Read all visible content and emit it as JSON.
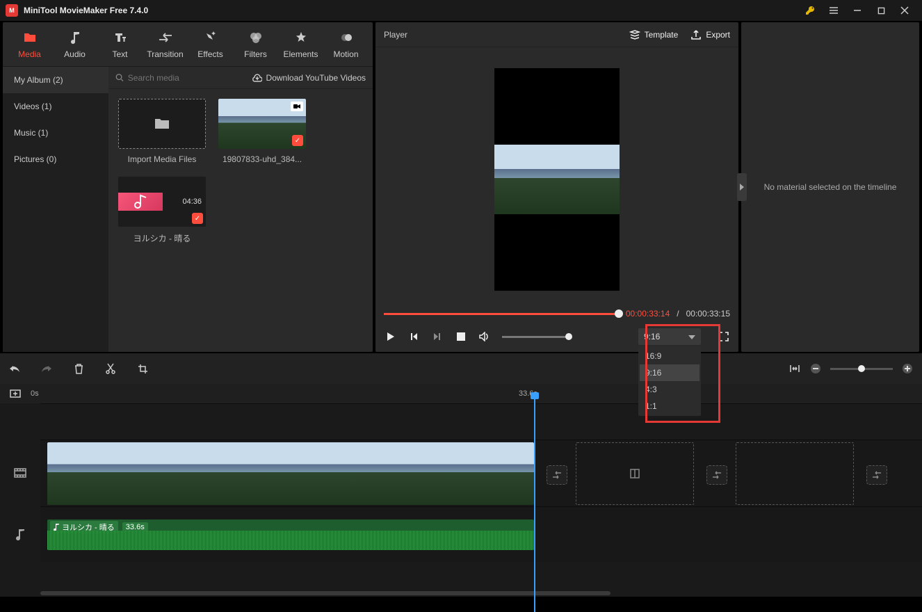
{
  "titlebar": {
    "title": "MiniTool MovieMaker Free 7.4.0"
  },
  "tabs": {
    "media": "Media",
    "audio": "Audio",
    "text": "Text",
    "transition": "Transition",
    "effects": "Effects",
    "filters": "Filters",
    "elements": "Elements",
    "motion": "Motion"
  },
  "media": {
    "sidebar": {
      "album": "My Album (2)",
      "videos": "Videos (1)",
      "music": "Music (1)",
      "pictures": "Pictures (0)"
    },
    "search_placeholder": "Search media",
    "download_link": "Download YouTube Videos",
    "import_label": "Import Media Files",
    "clip1": "19807833-uhd_384...",
    "clip2": {
      "label": "ヨルシカ - 晴る",
      "duration": "04:36"
    }
  },
  "player": {
    "title": "Player",
    "template": "Template",
    "export": "Export",
    "current": "00:00:33:14",
    "sep": "/",
    "total": "00:00:33:15",
    "ratio_selected": "9:16",
    "ratios": [
      "16:9",
      "9:16",
      "4:3",
      "1:1"
    ]
  },
  "side_panel": {
    "message": "No material selected on the timeline"
  },
  "timeline": {
    "start": "0s",
    "end": "33.6s",
    "audio_name": "ヨルシカ - 晴る",
    "audio_len": "33.6s"
  }
}
